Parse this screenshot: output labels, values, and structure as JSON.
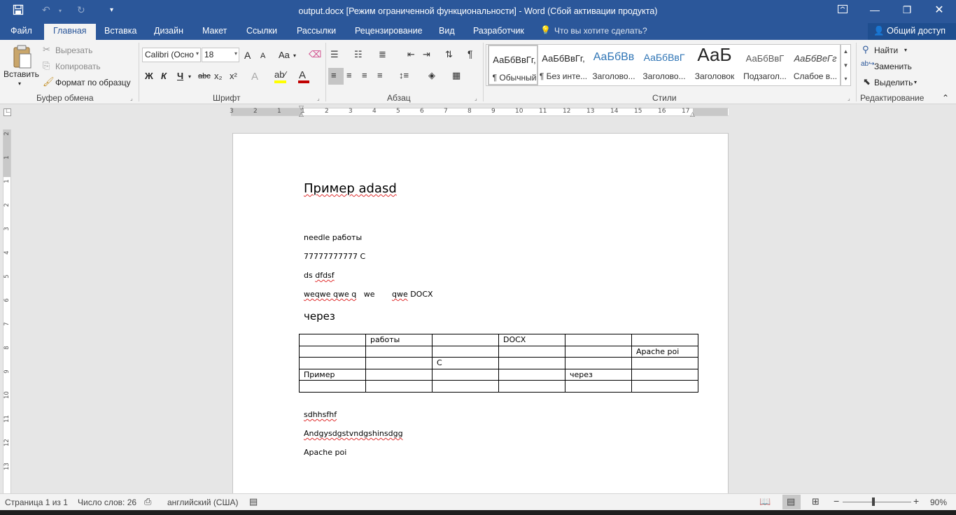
{
  "titlebar": {
    "title": "output.docx [Режим ограниченной функциональности] - Word (Сбой активации продукта)",
    "save_icon": "save-icon",
    "undo_icon": "undo-icon",
    "redo_icon": "redo-icon",
    "qat_more_icon": "chevron-down-icon",
    "ribbon_display_icon": "ribbon-display-icon",
    "minimize_icon": "minimize-icon",
    "restore_icon": "restore-icon",
    "close_icon": "close-icon"
  },
  "tabs": [
    {
      "label": "Файл"
    },
    {
      "label": "Главная"
    },
    {
      "label": "Вставка"
    },
    {
      "label": "Дизайн"
    },
    {
      "label": "Макет"
    },
    {
      "label": "Ссылки"
    },
    {
      "label": "Рассылки"
    },
    {
      "label": "Рецензирование"
    },
    {
      "label": "Вид"
    },
    {
      "label": "Разработчик"
    }
  ],
  "tellme": {
    "placeholder": "Что вы хотите сделать?"
  },
  "share": {
    "label": "Общий доступ"
  },
  "clipboard": {
    "paste": "Вставить",
    "cut": "Вырезать",
    "copy": "Копировать",
    "format_painter": "Формат по образцу",
    "group": "Буфер обмена"
  },
  "font": {
    "family": "Calibri (Осно",
    "size": "18",
    "group": "Шрифт",
    "bold": "Ж",
    "italic": "К",
    "underline": "Ч",
    "strike": "abc",
    "grow": "A",
    "shrink": "A",
    "case": "Aa",
    "color_accent": "#c00000",
    "highlight_accent": "#ffff00"
  },
  "paragraph": {
    "group": "Абзац"
  },
  "styles": {
    "group": "Стили",
    "items": [
      {
        "preview": "АаБбВвГг,",
        "label": "¶ Обычный"
      },
      {
        "preview": "АаБбВвГг,",
        "label": "¶ Без инте..."
      },
      {
        "preview": "АаБбВв",
        "label": "Заголово..."
      },
      {
        "preview": "АаБбВвГ",
        "label": "Заголово..."
      },
      {
        "preview": "АаБ",
        "label": "Заголовок"
      },
      {
        "preview": "АаБбВвГ",
        "label": "Подзагол..."
      },
      {
        "preview": "АаБбВеГг",
        "label": "Слабое в..."
      }
    ]
  },
  "editing": {
    "find": "Найти",
    "replace": "Заменить",
    "select": "Выделить",
    "group": "Редактирование"
  },
  "hruler": {
    "ticks": [
      "3",
      "2",
      "1",
      "1",
      "2",
      "3",
      "4",
      "5",
      "6",
      "7",
      "8",
      "9",
      "10",
      "11",
      "12",
      "13",
      "14",
      "15",
      "16",
      "17"
    ]
  },
  "vruler": {
    "ticks": [
      "2",
      "1",
      "1",
      "2",
      "3",
      "4",
      "5",
      "6",
      "7",
      "8",
      "9",
      "10",
      "11",
      "12",
      "13"
    ]
  },
  "document": {
    "heading": "Пример adasd",
    "line1": "needle работы",
    "line2": "77777777777 C",
    "line3_a": "ds ",
    "line3_b": "dfdsf",
    "line4_a": "weqwe qwe q",
    "line4_b": "   we       ",
    "line4_c": "qwe",
    "line4_d": " DOCX",
    "heading2": "через",
    "table": [
      [
        "",
        "работы",
        "",
        "DOCX",
        "",
        ""
      ],
      [
        "",
        "",
        "",
        "",
        "",
        "Apache poi"
      ],
      [
        "",
        "",
        "C",
        "",
        "",
        ""
      ],
      [
        "Пример",
        "",
        "",
        "",
        "через",
        ""
      ],
      [
        "",
        "",
        "",
        "",
        "",
        ""
      ]
    ],
    "after1": "sdhhsfhf",
    "after2": "Andgysdgstvndgshinsdgg",
    "after3": "Apache poi"
  },
  "status": {
    "page": "Страница 1 из 1",
    "words": "Число слов: 26",
    "language": "английский (США)",
    "zoom": "90%",
    "zoom_value": 0.9
  }
}
